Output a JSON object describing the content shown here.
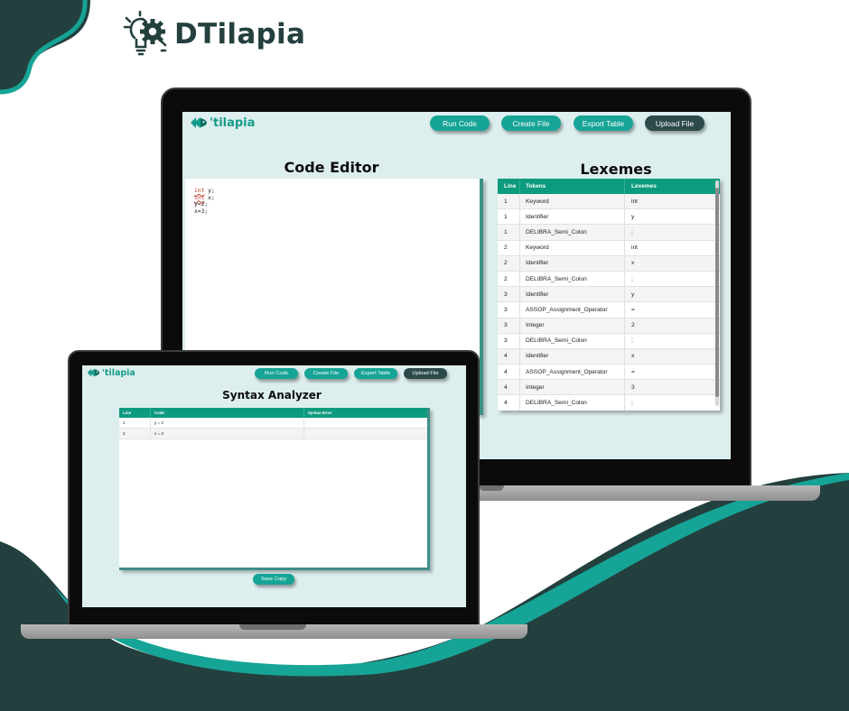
{
  "brand": {
    "title": "DTilapia",
    "icon": "lightbulb-gear-icon"
  },
  "colors": {
    "teal": "#16a496",
    "dark_teal": "#23403e",
    "table_header": "#0d9b7e",
    "screen_bg": "#ddeeee"
  },
  "app": {
    "logo_text": "'tilapia",
    "buttons": {
      "run": "Run Code",
      "create": "Create File",
      "export": "Export Table",
      "upload": "Upload File"
    }
  },
  "editor": {
    "title": "Code Editor",
    "lines": [
      {
        "kw": "int",
        "rest": " y;"
      },
      {
        "kw": "int",
        "rest": " x;"
      },
      {
        "kw": "",
        "rest": "y=2;"
      },
      {
        "kw": "",
        "rest": "x=3;"
      }
    ]
  },
  "lexemes": {
    "title": "Lexemes",
    "headers": {
      "line": "Line",
      "tokens": "Tokens",
      "lexemes": "Lexemes"
    },
    "rows": [
      {
        "line": "1",
        "token": "Keyword",
        "lexeme": "int"
      },
      {
        "line": "1",
        "token": "Identifier",
        "lexeme": "y"
      },
      {
        "line": "1",
        "token": "DELIBRA_Semi_Colon",
        "lexeme": ";"
      },
      {
        "line": "2",
        "token": "Keyword",
        "lexeme": "int"
      },
      {
        "line": "2",
        "token": "Identifier",
        "lexeme": "x"
      },
      {
        "line": "2",
        "token": "DELIBRA_Semi_Colon",
        "lexeme": ";"
      },
      {
        "line": "3",
        "token": "Identifier",
        "lexeme": "y"
      },
      {
        "line": "3",
        "token": "ASSOP_Assignment_Operator",
        "lexeme": "="
      },
      {
        "line": "3",
        "token": "Integer",
        "lexeme": "2"
      },
      {
        "line": "3",
        "token": "DELIBRA_Semi_Colon",
        "lexeme": ";"
      },
      {
        "line": "4",
        "token": "Identifier",
        "lexeme": "x"
      },
      {
        "line": "4",
        "token": "ASSOP_Assignment_Operator",
        "lexeme": "="
      },
      {
        "line": "4",
        "token": "Integer",
        "lexeme": "3"
      },
      {
        "line": "4",
        "token": "DELIBRA_Semi_Colon",
        "lexeme": ";"
      }
    ]
  },
  "syntax": {
    "title": "Syntax Analyzer",
    "headers": {
      "line": "Line",
      "code": "Code",
      "error": "Syntax Error"
    },
    "rows": [
      {
        "line": "1",
        "code": "y = 2",
        "error": ""
      },
      {
        "line": "2",
        "code": "x = 3",
        "error": ""
      }
    ],
    "save_label": "Save Copy"
  }
}
